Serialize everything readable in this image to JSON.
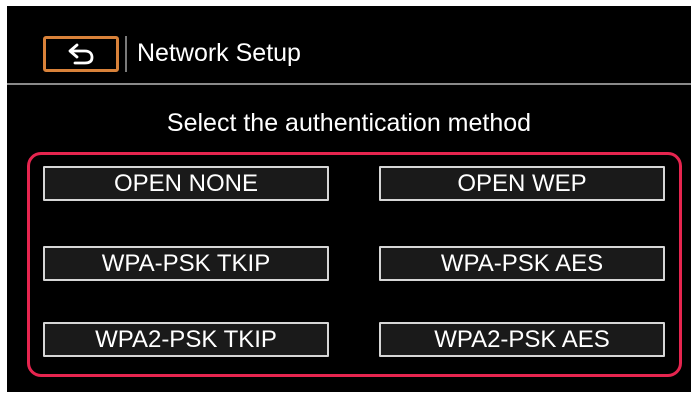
{
  "header": {
    "back_icon": "return-arrow-icon",
    "accent_color": "#d9823a",
    "title": "Network Setup"
  },
  "instruction": "Select the authentication method",
  "highlight_color": "#e6254f",
  "options": [
    {
      "label": "OPEN NONE"
    },
    {
      "label": "OPEN WEP"
    },
    {
      "label": "WPA-PSK TKIP"
    },
    {
      "label": "WPA-PSK AES"
    },
    {
      "label": "WPA2-PSK TKIP"
    },
    {
      "label": "WPA2-PSK AES"
    }
  ]
}
